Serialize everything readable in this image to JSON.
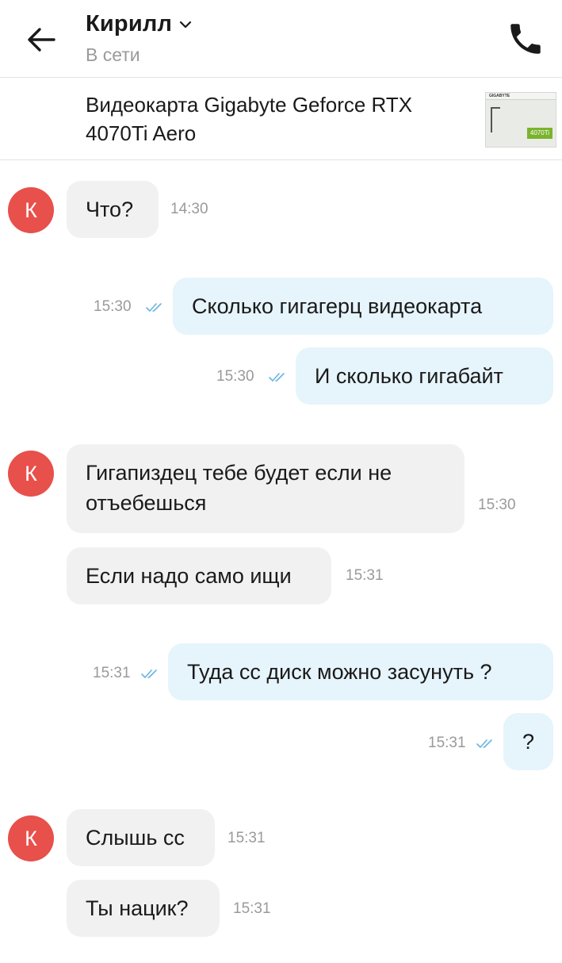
{
  "header": {
    "name": "Кирилл",
    "status": "В сети"
  },
  "product": {
    "title": "Видеокарта Gigabyte Geforce RTX 4070Ti Aero",
    "thumb_brand": "GIGABYTE",
    "thumb_badge": "4070Ti"
  },
  "avatar_letter": "К",
  "colors": {
    "avatar": "#e8504b",
    "incoming_bubble": "#f1f1f1",
    "outgoing_bubble": "#e6f4fc",
    "read_ticks": "#6bb4e3"
  },
  "messages": [
    {
      "dir": "in",
      "text": "Что?",
      "time": "14:30"
    },
    {
      "dir": "out",
      "text": "Сколько гигагерц видеокарта",
      "time": "15:30",
      "read": true
    },
    {
      "dir": "out",
      "text": "И сколько гигабайт",
      "time": "15:30",
      "read": true
    },
    {
      "dir": "in",
      "text": "Гигапиздец тебе будет если не отъебешься",
      "time": "15:30"
    },
    {
      "dir": "in",
      "text": "Если надо само ищи",
      "time": "15:31"
    },
    {
      "dir": "out",
      "text": "Туда сс диск можно засунуть ?",
      "time": "15:31",
      "read": true
    },
    {
      "dir": "out",
      "text": "?",
      "time": "15:31",
      "read": true
    },
    {
      "dir": "in",
      "text": "Слышь сс",
      "time": "15:31"
    },
    {
      "dir": "in",
      "text": "Ты нацик?",
      "time": "15:31"
    }
  ]
}
